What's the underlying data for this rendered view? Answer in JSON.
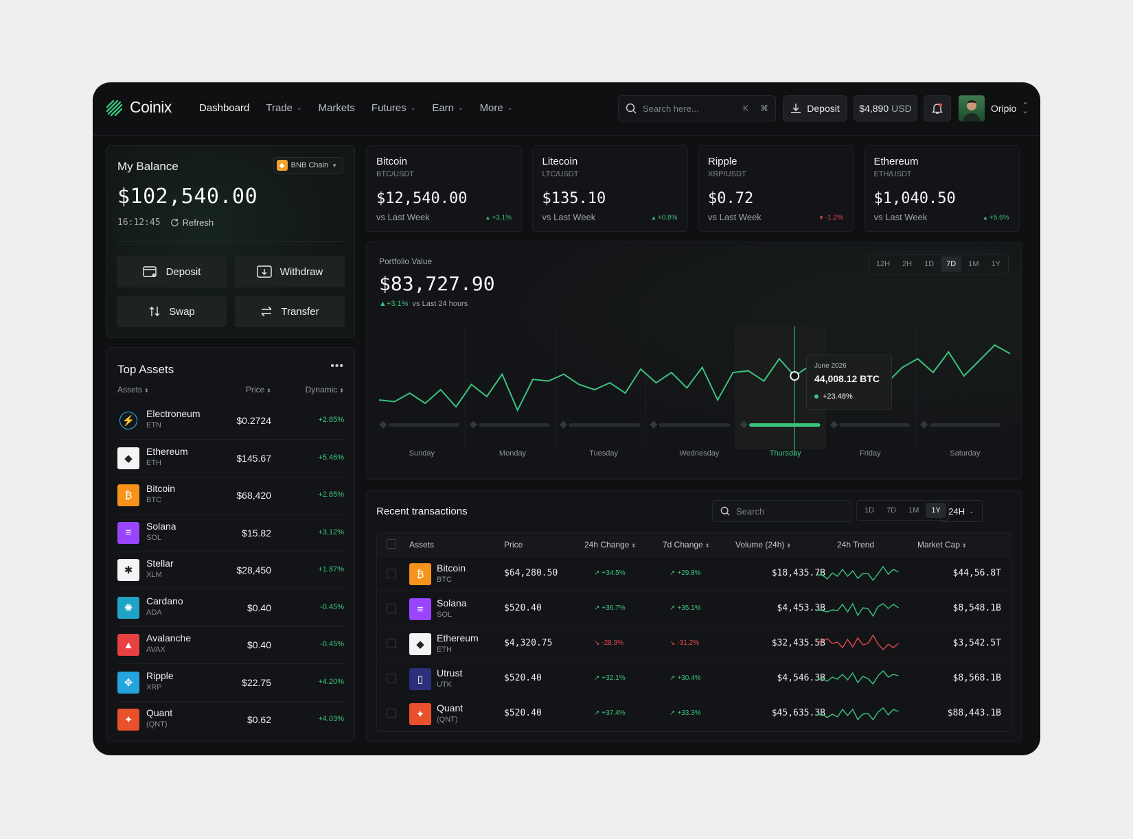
{
  "app": {
    "name": "Coinix"
  },
  "nav": {
    "items": [
      {
        "label": "Dashboard",
        "dropdown": false,
        "active": true
      },
      {
        "label": "Trade",
        "dropdown": true
      },
      {
        "label": "Markets",
        "dropdown": false
      },
      {
        "label": "Futures",
        "dropdown": true
      },
      {
        "label": "Earn",
        "dropdown": true
      },
      {
        "label": "More",
        "dropdown": true
      }
    ]
  },
  "search": {
    "placeholder": "Search here...",
    "shortcut_k": "K",
    "shortcut_cmd": "⌘"
  },
  "header": {
    "deposit_label": "Deposit",
    "balance_value": "$4,890",
    "balance_unit": "USD",
    "user_name": "Oripio"
  },
  "balance": {
    "title": "My Balance",
    "chain": "BNB Chain",
    "amount": "$102,540.00",
    "time": "16:12:45",
    "refresh_label": "Refresh",
    "actions": {
      "deposit": "Deposit",
      "withdraw": "Withdraw",
      "swap": "Swap",
      "transfer": "Transfer"
    }
  },
  "top_assets": {
    "title": "Top Assets",
    "headers": {
      "assets": "Assets",
      "price": "Price",
      "dynamic": "Dynamic"
    },
    "rows": [
      {
        "name": "Electroneum",
        "symbol": "ETN",
        "price": "$0.2724",
        "change": "+2.85%",
        "icon_color": "#15171a"
      },
      {
        "name": "Ethereum",
        "symbol": "ETH",
        "price": "$145.67",
        "change": "+5.46%",
        "icon_color": "#f4f4f4"
      },
      {
        "name": "Bitcoin",
        "symbol": "BTC",
        "price": "$68,420",
        "change": "+2.85%",
        "icon_color": "#f7931a"
      },
      {
        "name": "Solana",
        "symbol": "SOL",
        "price": "$15.82",
        "change": "+3.12%",
        "icon_color": "#9945ff"
      },
      {
        "name": "Stellar",
        "symbol": "XLM",
        "price": "$28,450",
        "change": "+1.87%",
        "icon_color": "#f4f4f4"
      },
      {
        "name": "Cardano",
        "symbol": "ADA",
        "price": "$0.40",
        "change": "-0.45%",
        "icon_color": "#1fa3c6"
      },
      {
        "name": "Avalanche",
        "symbol": "AVAX",
        "price": "$0.40",
        "change": "-0.45%",
        "icon_color": "#e84142"
      },
      {
        "name": "Ripple",
        "symbol": "XRP",
        "price": "$22.75",
        "change": "+4.20%",
        "icon_color": "#23a4dc"
      },
      {
        "name": "Quant",
        "symbol": "(QNT)",
        "price": "$0.62",
        "change": "+4.03%",
        "icon_color": "#e8512c"
      }
    ]
  },
  "tickers": [
    {
      "name": "Bitcoin",
      "pair": "BTC/USDT",
      "price": "$12,540.00",
      "vs": "vs Last Week",
      "change": "+3.1%",
      "up": true
    },
    {
      "name": "Litecoin",
      "pair": "LTC/USDT",
      "price": "$135.10",
      "vs": "vs Last Week",
      "change": "+0.8%",
      "up": true
    },
    {
      "name": "Ripple",
      "pair": "XRP/USDT",
      "price": "$0.72",
      "vs": "vs Last Week",
      "change": "-1.2%",
      "up": false
    },
    {
      "name": "Ethereum",
      "pair": "ETH/USDT",
      "price": "$1,040.50",
      "vs": "vs Last Week",
      "change": "+5.6%",
      "up": true
    }
  ],
  "portfolio": {
    "label": "Portfolio Value",
    "value": "$83,727.90",
    "change": "+3.1%",
    "change_note": "vs Last 24 hours",
    "timeframes": [
      "12H",
      "2H",
      "1D",
      "7D",
      "1M",
      "1Y"
    ],
    "active_timeframe": "7D",
    "tooltip": {
      "date": "June 2026",
      "value": "44,008.12 BTC",
      "change": "+23.48%"
    }
  },
  "chart_data": {
    "type": "line",
    "x": [
      "Sunday",
      "Monday",
      "Tuesday",
      "Wednesday",
      "Thursday",
      "Friday",
      "Saturday"
    ],
    "highlighted_category": "Thursday",
    "values": [
      48,
      47,
      52,
      46,
      54,
      44,
      57,
      50,
      63,
      42,
      60,
      59,
      63,
      57,
      54,
      58,
      52,
      66,
      58,
      64,
      55,
      67,
      48,
      64,
      65,
      59,
      72,
      62,
      68,
      72,
      59,
      60,
      70,
      58,
      67,
      72,
      64,
      76,
      62,
      71,
      80,
      75
    ],
    "grid": false,
    "legend": "none"
  },
  "transactions": {
    "title": "Recent transactions",
    "search_placeholder": "Search",
    "timeframes": [
      "1D",
      "7D",
      "1M",
      "1Y"
    ],
    "active_timeframe": "1Y",
    "interval": "24H",
    "headers": {
      "assets": "Assets",
      "price": "Price",
      "change24": "24h Change",
      "change7": "7d Change",
      "volume": "Volume (24h)",
      "trend": "24h Trend",
      "mcap": "Market Cap"
    },
    "rows": [
      {
        "name": "Bitcoin",
        "symbol": "BTC",
        "price": "$64,280.50",
        "change24": "+34.5%",
        "change7": "+29.8%",
        "volume": "$18,435.7B",
        "mcap": "$44,56.8T",
        "up": true,
        "icon_color": "#f7931a"
      },
      {
        "name": "Solana",
        "symbol": "SOL",
        "price": "$520.40",
        "change24": "+36.7%",
        "change7": "+35.1%",
        "volume": "$4,453.3B",
        "mcap": "$8,548.1B",
        "up": true,
        "icon_color": "#9945ff"
      },
      {
        "name": "Ethereum",
        "symbol": "ETH",
        "price": "$4,320.75",
        "change24": "-28.9%",
        "change7": "-31.2%",
        "volume": "$32,435.5B",
        "mcap": "$3,542.5T",
        "up": false,
        "icon_color": "#f4f4f4"
      },
      {
        "name": "Utrust",
        "symbol": "UTK",
        "price": "$520.40",
        "change24": "+32.1%",
        "change7": "+30.4%",
        "volume": "$4,546.3B",
        "mcap": "$8,568.1B",
        "up": true,
        "icon_color": "#2c2f7a"
      },
      {
        "name": "Quant",
        "symbol": "(QNT)",
        "price": "$520.40",
        "change24": "+37.4%",
        "change7": "+33.3%",
        "volume": "$45,635.3B",
        "mcap": "$88,443.1B",
        "up": true,
        "icon_color": "#e8512c"
      }
    ]
  },
  "colors": {
    "accent": "#3bc47e",
    "negative": "#e5484d",
    "background": "#0f1012"
  }
}
